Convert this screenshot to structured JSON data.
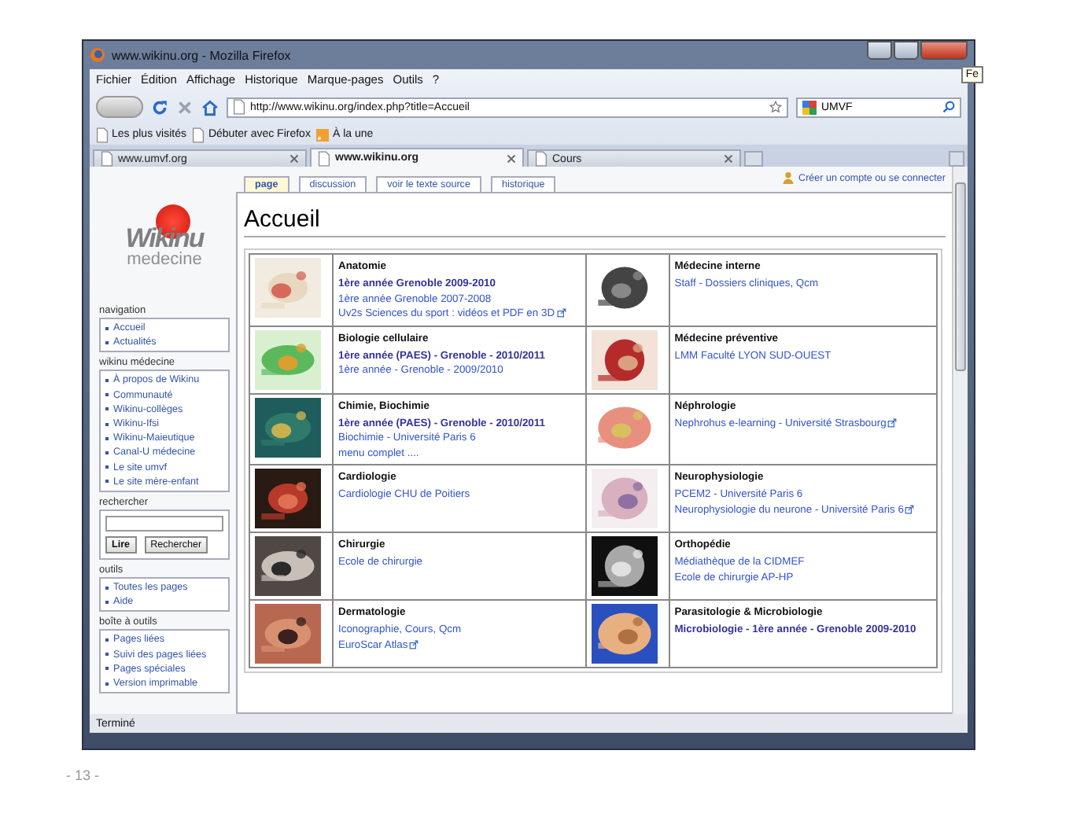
{
  "window": {
    "title": "www.wikinu.org - Mozilla Firefox",
    "tooltip": "Fe"
  },
  "menu": [
    "Fichier",
    "Édition",
    "Affichage",
    "Historique",
    "Marque-pages",
    "Outils",
    "?"
  ],
  "address": {
    "value": "http://www.wikinu.org/index.php?title=Accueil"
  },
  "search": {
    "value": "UMVF"
  },
  "bookmarks": [
    "Les plus visités",
    "Débuter avec Firefox",
    "À la une"
  ],
  "tabs": [
    {
      "label": "www.umvf.org",
      "selected": false
    },
    {
      "label": "www.wikinu.org",
      "selected": true
    },
    {
      "label": "Cours",
      "selected": false
    }
  ],
  "user_link": "Créer un compte ou se connecter",
  "logo": {
    "word": "Wikinu",
    "subtitle": "medecine"
  },
  "sidebar": [
    {
      "kind": "links",
      "title": "navigation",
      "items": [
        "Accueil",
        "Actualités"
      ]
    },
    {
      "kind": "links",
      "title": "wikinu médecine",
      "items": [
        "À propos de Wikinu",
        "Communauté",
        "Wikinu-collèges",
        "Wikinu-Ifsi",
        "Wikinu-Maieutique",
        "Canal-U médecine",
        "Le site umvf",
        "Le site mère-enfant"
      ]
    },
    {
      "kind": "search",
      "title": "rechercher",
      "items": [
        "Lire",
        "Rechercher"
      ]
    },
    {
      "kind": "links",
      "title": "outils",
      "items": [
        "Toutes les pages",
        "Aide"
      ]
    },
    {
      "kind": "links",
      "title": "boîte à outils",
      "items": [
        "Pages liées",
        "Suivi des pages liées",
        "Pages spéciales",
        "Version imprimable"
      ]
    }
  ],
  "page_tabs": [
    {
      "label": "page",
      "selected": true
    },
    {
      "label": "discussion",
      "selected": false
    },
    {
      "label": "voir le texte source",
      "selected": false
    },
    {
      "label": "historique",
      "selected": false
    }
  ],
  "heading": "Accueil",
  "table": [
    {
      "cells": [
        {
          "title": "Anatomie",
          "links": [
            {
              "text": "1ère année Grenoble 2009-2010",
              "kind": "bold",
              "external": false
            },
            {
              "text": "1ère année Grenoble 2007-2008",
              "kind": "plain",
              "external": false
            },
            {
              "text": "Uv2s Sciences du sport : vidéos et PDF en 3D",
              "kind": "plain",
              "external": true
            }
          ]
        },
        {
          "title": "Médecine interne",
          "links": [
            {
              "text": "Staff - Dossiers cliniques, Qcm",
              "kind": "plain",
              "external": false
            }
          ]
        }
      ]
    },
    {
      "cells": [
        {
          "title": "Biologie cellulaire",
          "links": [
            {
              "text": "1ère année (PAES) - Grenoble - 2010/2011",
              "kind": "bold",
              "external": false
            },
            {
              "text": "1ère année - Grenoble - 2009/2010",
              "kind": "plain",
              "external": false
            }
          ]
        },
        {
          "title": "Médecine préventive",
          "links": [
            {
              "text": "LMM Faculté LYON SUD-OUEST",
              "kind": "plain",
              "external": false
            }
          ]
        }
      ]
    },
    {
      "cells": [
        {
          "title": "Chimie, Biochimie",
          "links": [
            {
              "text": "1ère année (PAES) - Grenoble - 2010/2011",
              "kind": "bold",
              "external": false
            },
            {
              "text": "Biochimie - Université Paris 6",
              "kind": "plain",
              "external": false
            },
            {
              "text": "menu complet ....",
              "kind": "plain",
              "external": false
            }
          ]
        },
        {
          "title": "Néphrologie",
          "links": [
            {
              "text": "Nephrohus e-learning - Université Strasbourg",
              "kind": "plain",
              "external": true
            }
          ]
        }
      ]
    },
    {
      "cells": [
        {
          "title": "Cardiologie",
          "links": [
            {
              "text": "Cardiologie CHU de Poitiers",
              "kind": "plain",
              "external": false
            }
          ]
        },
        {
          "title": "Neurophysiologie",
          "links": [
            {
              "text": "PCEM2 - Université Paris 6",
              "kind": "plain",
              "external": false
            },
            {
              "text": "Neurophysiologie du neurone - Université Paris 6",
              "kind": "plain",
              "external": true
            }
          ]
        }
      ]
    },
    {
      "cells": [
        {
          "title": "Chirurgie",
          "links": [
            {
              "text": "Ecole de chirurgie",
              "kind": "plain",
              "external": false
            }
          ]
        },
        {
          "title": "Orthopédie",
          "links": [
            {
              "text": "Médiathèque de la CIDMEF",
              "kind": "plain",
              "external": false
            },
            {
              "text": "Ecole de chirurgie AP-HP",
              "kind": "plain",
              "external": false
            }
          ]
        }
      ]
    },
    {
      "cells": [
        {
          "title": "Dermatologie",
          "links": [
            {
              "text": "Iconographie, Cours, Qcm",
              "kind": "plain",
              "external": false
            },
            {
              "text": "EuroScar Atlas",
              "kind": "plain",
              "external": true
            }
          ]
        },
        {
          "title": "Parasitologie & Microbiologie",
          "links": [
            {
              "text": "Microbiologie - 1ère année - Grenoble 2009-2010",
              "kind": "bold",
              "external": false
            }
          ]
        }
      ]
    }
  ],
  "status": "Terminé",
  "slide": {
    "page_number": "- 13 -"
  }
}
